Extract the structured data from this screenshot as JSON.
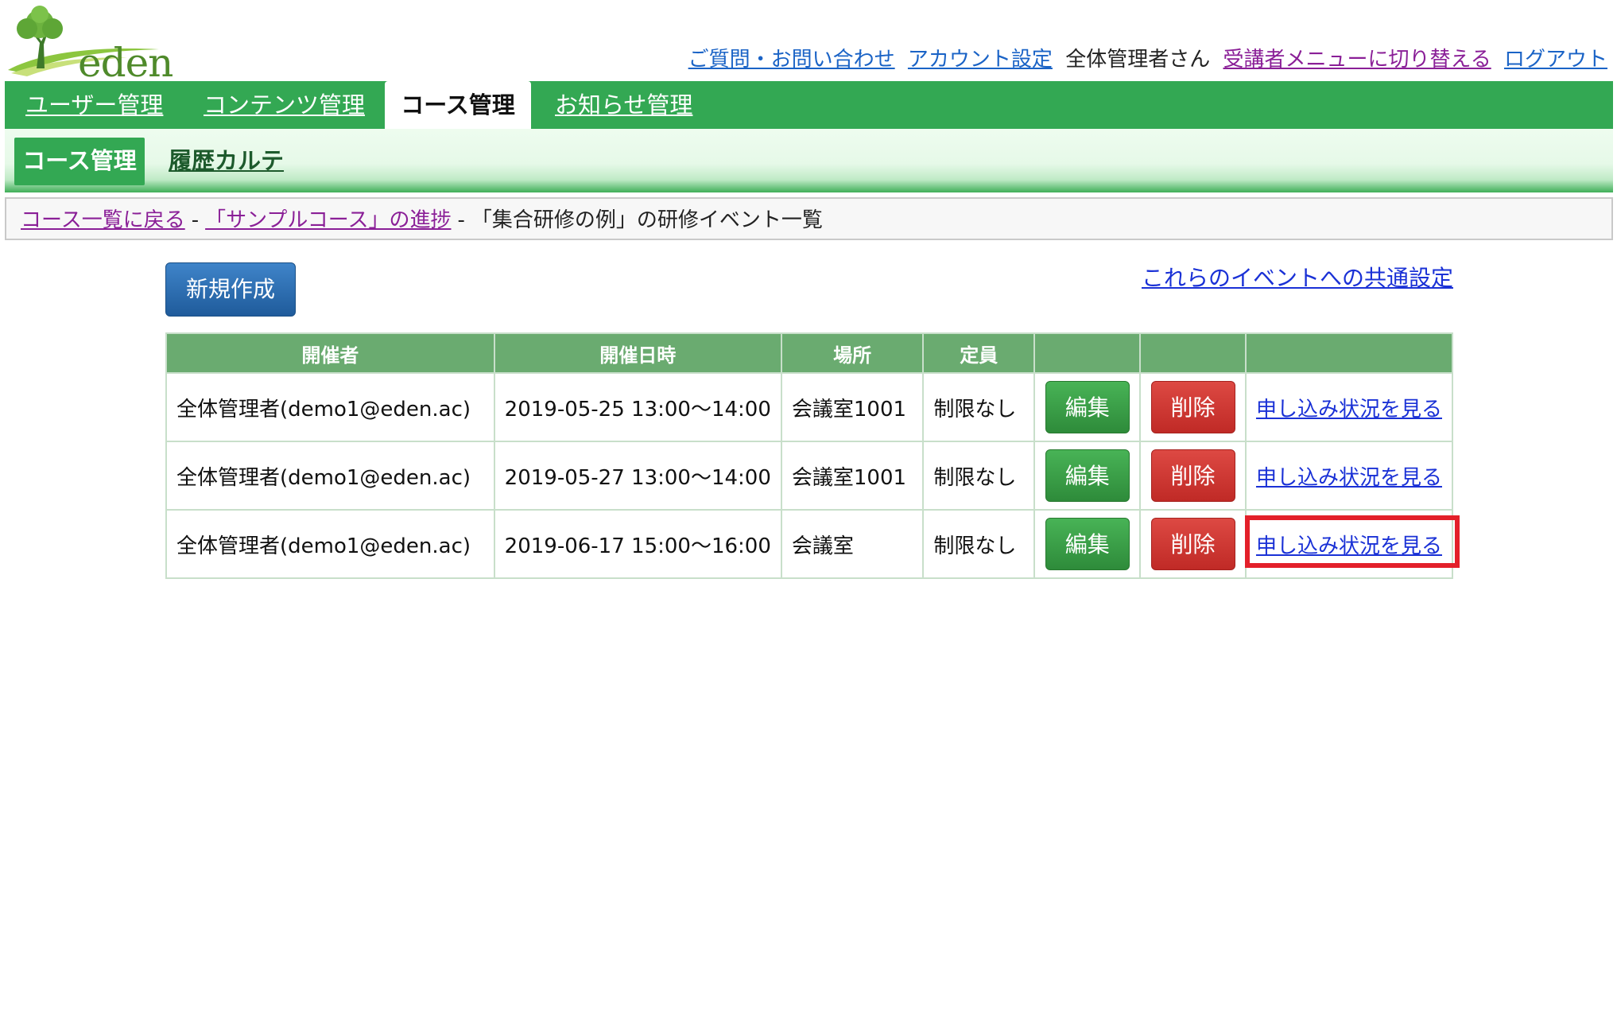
{
  "brand": {
    "logo_text": "eden"
  },
  "top_links": {
    "faq": "ご質問・お問い合わせ",
    "account": "アカウント設定",
    "user_label": "全体管理者さん",
    "switch_menu": "受講者メニューに切り替える",
    "logout": "ログアウト"
  },
  "main_nav": {
    "tabs": [
      {
        "label": "ユーザー管理",
        "active": false
      },
      {
        "label": "コンテンツ管理",
        "active": false
      },
      {
        "label": "コース管理",
        "active": true
      },
      {
        "label": "お知らせ管理",
        "active": false
      }
    ]
  },
  "sub_nav": {
    "tabs": [
      {
        "label": "コース管理",
        "active": true
      },
      {
        "label": "履歴カルテ",
        "active": false
      }
    ]
  },
  "breadcrumb": {
    "back_to_list": "コース一覧に戻る",
    "separator": "-",
    "course_progress": "「サンプルコース」の進捗",
    "current": "「集合研修の例」の研修イベント一覧"
  },
  "actions": {
    "new_button": "新規作成",
    "common_settings": "これらのイベントへの共通設定"
  },
  "table": {
    "headers": [
      "開催者",
      "開催日時",
      "場所",
      "定員",
      "",
      "",
      ""
    ],
    "rows": [
      {
        "organizer": "全体管理者(demo1@eden.ac)",
        "datetime": "2019-05-25 13:00～14:00",
        "place": "会議室1001",
        "capacity": "制限なし",
        "edit": "編集",
        "delete": "削除",
        "view": "申し込み状況を見る"
      },
      {
        "organizer": "全体管理者(demo1@eden.ac)",
        "datetime": "2019-05-27 13:00～14:00",
        "place": "会議室1001",
        "capacity": "制限なし",
        "edit": "編集",
        "delete": "削除",
        "view": "申し込み状況を見る"
      },
      {
        "organizer": "全体管理者(demo1@eden.ac)",
        "datetime": "2019-06-17 15:00～16:00",
        "place": "会議室",
        "capacity": "制限なし",
        "edit": "編集",
        "delete": "削除",
        "view": "申し込み状況を見る"
      }
    ]
  },
  "colors": {
    "nav_green": "#33a853",
    "header_green": "#6aab70",
    "edit_green": "#3fa24b",
    "delete_red": "#cf3530",
    "primary_blue": "#2a6db0",
    "highlight_red": "#e3202a"
  }
}
